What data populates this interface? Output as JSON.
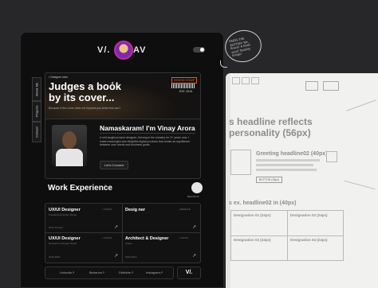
{
  "header": {
    "logo_left": "V/.",
    "logo_right": "AV"
  },
  "hero": {
    "eyebrow": "• Designer intro",
    "title_line1": "Judges a book",
    "title_line2": "by its cover...",
    "subtitle": "Because if the cover does not impress you what else can?",
    "badge_top": "DESIGN STAMP",
    "badge_bottom": "EST. 2019"
  },
  "side_tabs": [
    "About Me",
    "Projects",
    "Contact"
  ],
  "intro": {
    "greeting": "Namaskaram! I'm Vinay Arora",
    "bio": "A self-taught product designer, thriving in the industry for 3+ years now. I make meaningful and delightful digital products that create an equilibrium between user needs and business goals.",
    "cta": "Let's Connect"
  },
  "work": {
    "title": "Work Experience",
    "badge": "BEHANCE",
    "jobs": [
      {
        "role": "UX/UI Designer",
        "company": "Freelancing Design Studio",
        "tag": "• FUKOS",
        "period": "2021-Present"
      },
      {
        "role": "Desig ner",
        "company": "",
        "tag": "• REMOTE",
        "period": ""
      },
      {
        "role": "UX/UI Designer",
        "company": "Research & Design Studio",
        "tag": "• FUKOS",
        "period": "2019-2020"
      },
      {
        "role": "Architect & Designer",
        "company": "Studio",
        "tag": "• FUKOS",
        "period": "2016-2019"
      }
    ]
  },
  "footer": {
    "links": [
      "LinkedIn↗",
      "Behance↗",
      "Dribbble↗",
      "Instagram↗"
    ],
    "logo": "V/."
  },
  "wireframe": {
    "headline1": "s headline reflects",
    "headline2": "personality (56px)",
    "greeting_h2": "Greeting headline02 (40px)",
    "button": "BUTTON (18px)",
    "section_h2": "s ex. headline02 in (40px)",
    "designation1": "Designation 01 (24px)",
    "designation2": "Designation 02 (24px)",
    "designation3": "Designation 03 (24px)",
    "designation4": "Designation 04 (24px)",
    "sticky_note": "PRESS THE BUTTON! Yes. Brace! A head start! Toothily things!"
  },
  "colors": {
    "accent": "#e25a2a",
    "dark_bg": "#0e0e0f",
    "page_bg": "#27272a",
    "wire_bg": "#f1f1ef"
  }
}
